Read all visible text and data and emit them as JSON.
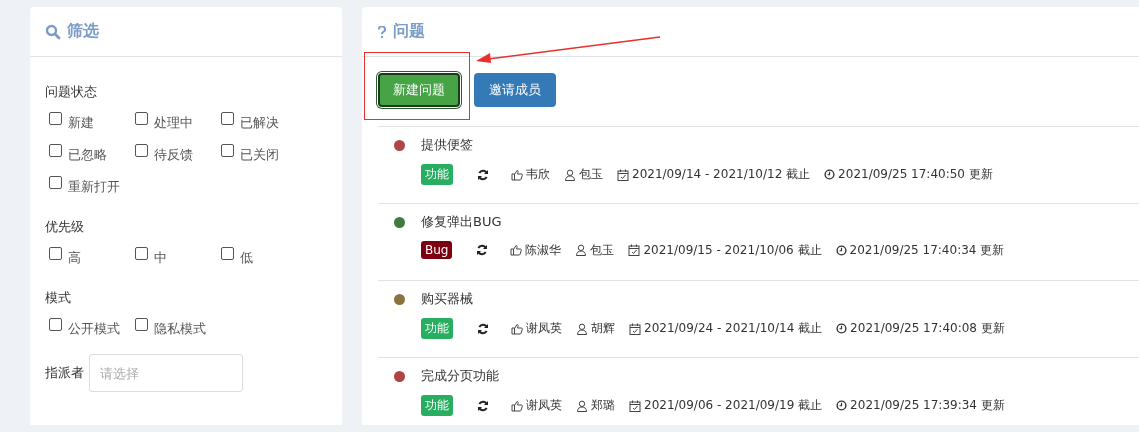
{
  "filter": {
    "title": "筛选",
    "groups": [
      {
        "label": "问题状态",
        "options": [
          {
            "label": "新建",
            "checked": false
          },
          {
            "label": "处理中",
            "checked": false
          },
          {
            "label": "已解决",
            "checked": false
          },
          {
            "label": "已忽略",
            "checked": false
          },
          {
            "label": "待反馈",
            "checked": false
          },
          {
            "label": "已关闭",
            "checked": false
          },
          {
            "label": "重新打开",
            "checked": false
          }
        ]
      },
      {
        "label": "优先级",
        "options": [
          {
            "label": "高",
            "checked": false
          },
          {
            "label": "中",
            "checked": false
          },
          {
            "label": "低",
            "checked": false
          }
        ]
      },
      {
        "label": "模式",
        "options": [
          {
            "label": "公开模式",
            "checked": false
          },
          {
            "label": "隐私模式",
            "checked": false
          }
        ]
      }
    ],
    "assignee": {
      "label": "指派者",
      "placeholder": "请选择"
    }
  },
  "issues": {
    "title": "问题",
    "buttons": [
      {
        "label": "新建问题",
        "kind": "success",
        "focused": true
      },
      {
        "label": "邀请成员",
        "kind": "primary",
        "focused": false
      }
    ],
    "items": [
      {
        "title": "提供便签",
        "color": "#b04545",
        "tag": {
          "label": "功能",
          "kind": "feature"
        },
        "reporter": "韦欣",
        "assignee": "包玉",
        "dates": "2021/09/14 - 2021/10/12 截止",
        "updated": "2021/09/25 17:40:50 更新"
      },
      {
        "title": "修复弹出BUG",
        "color": "#3f7a3f",
        "tag": {
          "label": "Bug",
          "kind": "bug"
        },
        "reporter": "陈淑华",
        "assignee": "包玉",
        "dates": "2021/09/15 - 2021/10/06 截止",
        "updated": "2021/09/25 17:40:34 更新"
      },
      {
        "title": "购买器械",
        "color": "#8f713f",
        "tag": {
          "label": "功能",
          "kind": "feature"
        },
        "reporter": "谢凤英",
        "assignee": "胡辉",
        "dates": "2021/09/24 - 2021/10/14 截止",
        "updated": "2021/09/25 17:40:08 更新"
      },
      {
        "title": "完成分页功能",
        "color": "#b04545",
        "tag": {
          "label": "功能",
          "kind": "feature"
        },
        "reporter": "谢凤英",
        "assignee": "郑璐",
        "dates": "2021/09/06 - 2021/09/19 截止",
        "updated": "2021/09/25 17:39:34 更新"
      }
    ]
  }
}
